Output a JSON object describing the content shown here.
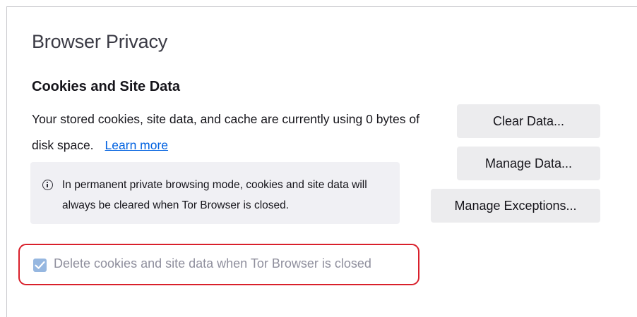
{
  "page": {
    "title": "Browser Privacy"
  },
  "cookies": {
    "heading": "Cookies and Site Data",
    "description": "Your stored cookies, site data, and cache are currently using 0 bytes of disk space.",
    "learn_more": "Learn more",
    "info_text": "In permanent private browsing mode, cookies and site data will always be cleared when Tor Browser is closed.",
    "buttons": {
      "clear_data": "Clear Data...",
      "manage_data": "Manage Data...",
      "manage_exceptions": "Manage Exceptions..."
    },
    "delete_on_close": {
      "label": "Delete cookies and site data when Tor Browser is closed",
      "checked": true,
      "disabled": true
    }
  },
  "colors": {
    "link": "#0061e0",
    "highlight_border": "#d9202b",
    "checkbox_disabled_fill": "#96b7e0",
    "button_bg": "#ececee",
    "info_bg": "#f0f0f4"
  },
  "icons": {
    "info": "info-circle-icon",
    "checkbox_check": "checkmark-icon"
  }
}
